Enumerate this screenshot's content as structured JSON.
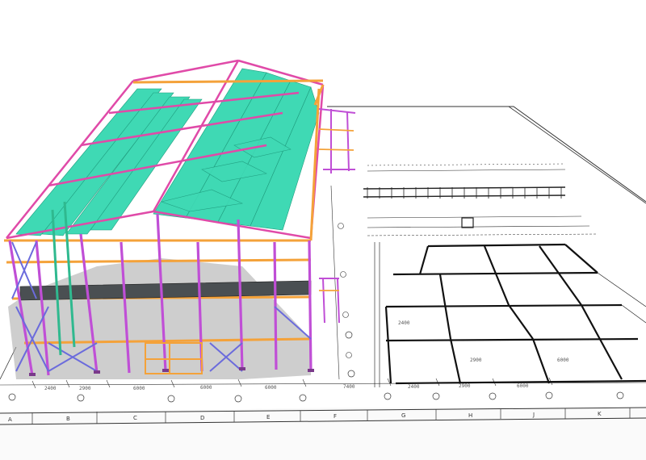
{
  "scene": {
    "subject": "steel-frame-building-3d-model-on-blueprint",
    "colors": {
      "background": "#ffffff",
      "paper_line": "#2a2a2a",
      "column": "#c04fd6",
      "beam": "#f4a23a",
      "purlin": "#3fd9b4",
      "rafter": "#e04aa8",
      "brace": "#6b6bdc",
      "shadow": "#9a9a9a"
    }
  },
  "blueprint": {
    "grid_letters": [
      "A",
      "B",
      "C",
      "D",
      "E",
      "F",
      "G",
      "H",
      "J",
      "K"
    ],
    "dimension_labels": [
      "2400",
      "2900",
      "6000",
      "6000",
      "6000",
      "7400",
      "2400",
      "2900",
      "6000"
    ],
    "span_labels": [
      "2400",
      "2900",
      "6000"
    ]
  }
}
